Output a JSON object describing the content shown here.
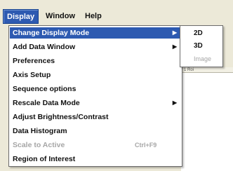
{
  "menubar": {
    "items": [
      {
        "label": "Display"
      },
      {
        "label": "Window"
      },
      {
        "label": "Help"
      }
    ]
  },
  "display_menu": {
    "items": [
      {
        "label": "Change Display Mode",
        "submenu_arrow": "▶"
      },
      {
        "label": "Add Data Window",
        "submenu_arrow": "▶"
      },
      {
        "label": "Preferences"
      },
      {
        "label": "Axis Setup"
      },
      {
        "label": "Sequence options"
      },
      {
        "label": "Rescale Data Mode",
        "submenu_arrow": "▶"
      },
      {
        "label": "Adjust Brightness/Contrast"
      },
      {
        "label": "Data Histogram"
      },
      {
        "label": "Scale to Active",
        "shortcut": "Ctrl+F9"
      },
      {
        "label": "Region of Interest"
      }
    ]
  },
  "display_mode_submenu": {
    "items": [
      {
        "label": "2D"
      },
      {
        "label": "3D"
      },
      {
        "label": "Image"
      }
    ]
  },
  "content_strip": {
    "label": "1 Roi"
  }
}
